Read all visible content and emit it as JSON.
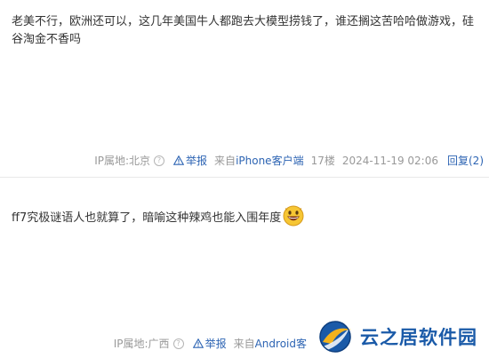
{
  "posts": [
    {
      "content": "老美不行，欧洲还可以，这几年美国牛人都跑去大模型捞钱了，谁还搁这苦哈哈做游戏，硅谷淘金不香吗",
      "meta": {
        "ip": "IP属地:北京",
        "help_icon": "question-circle-icon",
        "report_icon": "warning-triangle-icon",
        "report_label": "举报",
        "source_prefix": "来自",
        "source_link": "iPhone客户端",
        "floor": "17楼",
        "time": "2024-11-19 02:06",
        "reply_label": "回复(2)"
      }
    },
    {
      "content": "ff7究极谜语人也就算了，暗喻这种辣鸡也能入围年度",
      "emoji": "grinning-face-emoji",
      "meta": {
        "ip": "IP属地:广西",
        "help_icon": "question-circle-icon",
        "report_icon": "warning-triangle-icon",
        "report_label": "举报",
        "source_prefix": "来自",
        "source_link": "Android客"
      }
    }
  ],
  "watermark": {
    "text": "云之居软件园",
    "color": "#1a5aa8"
  },
  "colors": {
    "link": "#2d64b3",
    "meta_text": "#999999",
    "body_text": "#333333"
  }
}
